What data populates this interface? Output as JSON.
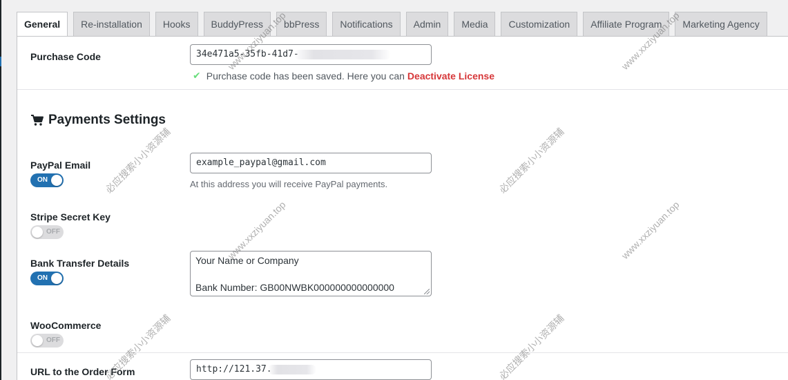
{
  "tabs": [
    {
      "label": "General",
      "active": true
    },
    {
      "label": "Re-installation",
      "active": false
    },
    {
      "label": "Hooks",
      "active": false
    },
    {
      "label": "BuddyPress",
      "active": false
    },
    {
      "label": "bbPress",
      "active": false
    },
    {
      "label": "Notifications",
      "active": false
    },
    {
      "label": "Admin",
      "active": false
    },
    {
      "label": "Media",
      "active": false
    },
    {
      "label": "Customization",
      "active": false
    },
    {
      "label": "Affiliate Program",
      "active": false
    },
    {
      "label": "Marketing Agency",
      "active": false
    }
  ],
  "purchase": {
    "label": "Purchase Code",
    "value_visible": "34e471a5-35fb-41d7-",
    "saved_message": "Purchase code has been saved. Here you can",
    "deactivate_label": "Deactivate License"
  },
  "payments": {
    "title": "Payments Settings",
    "icon": "cart-icon"
  },
  "paypal": {
    "label": "PayPal Email",
    "value": "example_paypal@gmail.com",
    "description": "At this address you will receive PayPal payments.",
    "toggle": "ON"
  },
  "stripe": {
    "label": "Stripe Secret Key",
    "toggle": "OFF"
  },
  "bank": {
    "label": "Bank Transfer Details",
    "line1": "Your Name or Company",
    "line2": "Bank Number: GB00NWBK000000000000000",
    "toggle": "ON"
  },
  "woocommerce": {
    "label": "WooCommerce",
    "toggle": "OFF"
  },
  "order_form": {
    "label": "URL to the Order Form",
    "value_visible": "http://121.37."
  },
  "watermarks": {
    "latin": "www.xxziyuan.top",
    "chinese": "必应搜索小小资源辅"
  },
  "colors": {
    "accent": "#2271b1",
    "danger": "#d63638",
    "success": "#68de7c"
  }
}
